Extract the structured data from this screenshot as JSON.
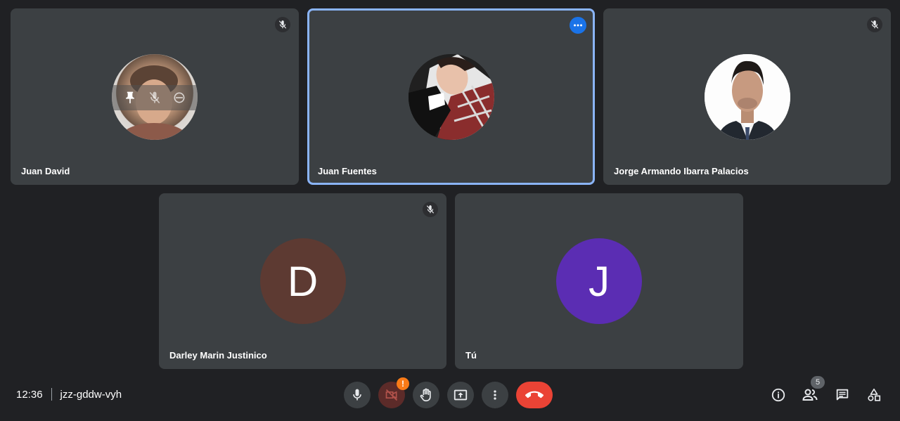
{
  "participants": [
    {
      "name": "Juan David",
      "muted": true,
      "avatar_type": "photo",
      "hover_controls": [
        "pin-icon",
        "mute-icon",
        "remove-icon"
      ]
    },
    {
      "name": "Juan Fuentes",
      "muted": false,
      "avatar_type": "photo",
      "active_speaker": true
    },
    {
      "name": "Jorge Armando Ibarra Palacios",
      "muted": true,
      "avatar_type": "photo"
    },
    {
      "name": "Darley Marin Justinico",
      "muted": true,
      "avatar_type": "letter",
      "letter": "D",
      "avatar_color": "#5d3a32"
    },
    {
      "name": "Tú",
      "muted": false,
      "avatar_type": "letter",
      "letter": "J",
      "avatar_color": "#5b2db3"
    }
  ],
  "meeting": {
    "time": "12:36",
    "code": "jzz-gddw-vyh"
  },
  "controls": {
    "camera_alert": "!",
    "people_count": "5"
  },
  "icons": {
    "mic": "mic-icon",
    "camera": "camera-off-icon",
    "hand": "raise-hand-icon",
    "present": "present-screen-icon",
    "more": "more-options-icon",
    "end": "end-call-icon",
    "info": "info-icon",
    "people": "people-icon",
    "chat": "chat-icon",
    "activities": "activities-icon"
  },
  "colors": {
    "background": "#202124",
    "tile": "#3c4043",
    "active_border": "#8ab4f8",
    "end_call": "#ea4335",
    "alert": "#fa7b17"
  }
}
